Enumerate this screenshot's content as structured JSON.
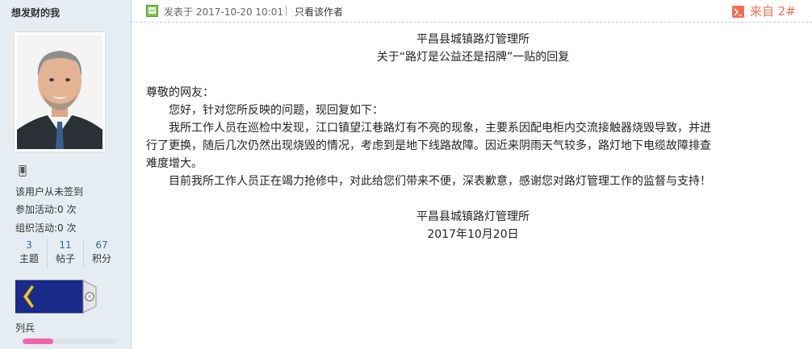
{
  "user": {
    "name": "想发财的我",
    "sign_status": "该用户从未签到",
    "activity_joined_label": "参加活动:",
    "activity_joined_value": "0 次",
    "activity_organized_label": "组织活动:",
    "activity_organized_value": "0 次",
    "counts": [
      {
        "value": "3",
        "label": "主题"
      },
      {
        "value": "11",
        "label": "帖子"
      },
      {
        "value": "67",
        "label": "积分"
      }
    ],
    "rank": "列兵",
    "rank_progress": 0.33
  },
  "post": {
    "posted_prefix": "发表于",
    "posted_time": "2017-10-20 10:01",
    "author_only": "只看该作者",
    "floor": "来自 2#",
    "org_title": "平昌县城镇路灯管理所",
    "subject": "关于“路灯是公益还是招牌”一贴的回复",
    "greeting": "尊敬的网友：",
    "para1": "您好，针对您所反映的问题，现回复如下：",
    "para2_line1": "我所工作人员在巡检中发现，江口镇望江巷路灯有不亮的现象，主要系因配电柜内交流接触器烧毁导致，并进",
    "para2_line2": "行了更换，随后几次仍然出现烧毁的情况，考虑到是地下线路故障。因近来阴雨天气较多，路灯地下电缆故障排查",
    "para2_line3": "难度增大。",
    "para3": "目前我所工作人员正在竭力抢修中，对此给您们带来不便，深表歉意，感谢您对路灯管理工作的监督与支持！",
    "signature": "平昌县城镇路灯管理所",
    "date": "2017年10月20日"
  },
  "colors": {
    "sidebar_bg": "#e5edf2",
    "floor": "#f26c4f",
    "count_number": "#336699",
    "rank_bar": "#ee66aa"
  },
  "icons": [
    "phone-icon",
    "online-status-icon",
    "from-icon",
    "rank-badge-icon"
  ]
}
